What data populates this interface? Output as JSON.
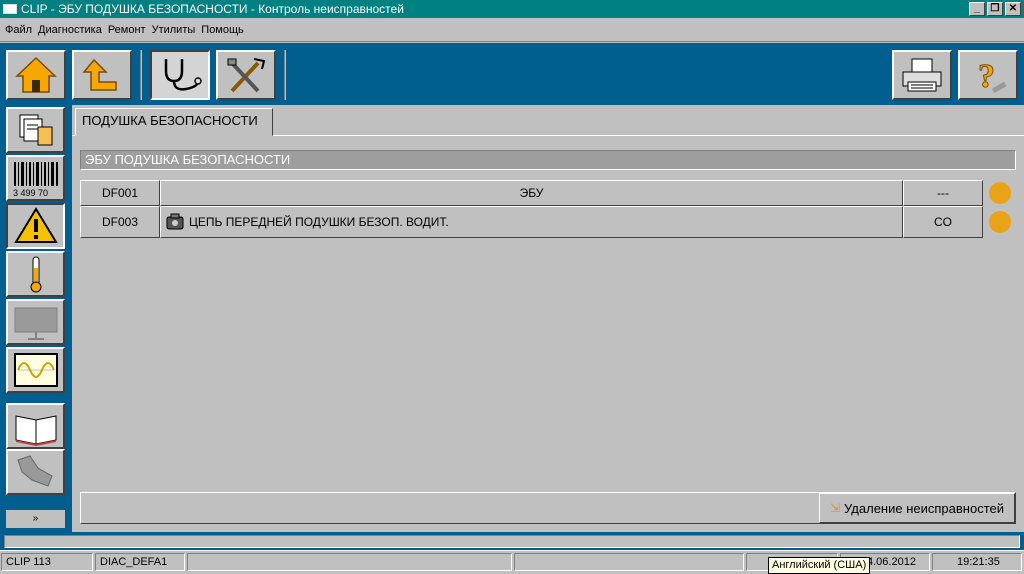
{
  "window": {
    "title": "CLIP - ЭБУ ПОДУШКА БЕЗОПАСНОСТИ - Контроль неисправностей",
    "controls": [
      "_",
      "❐",
      "✕"
    ]
  },
  "menu": [
    "Файл",
    "Диагностика",
    "Ремонт",
    "Утилиты",
    "Помощь"
  ],
  "toolbar": {
    "buttons": [
      {
        "name": "home-button",
        "icon": "home-icon"
      },
      {
        "name": "back-button",
        "icon": "arrow-up-icon"
      },
      {
        "name": "diagnostic-button",
        "icon": "stethoscope-icon"
      },
      {
        "name": "repair-button",
        "icon": "tools-icon"
      },
      {
        "name": "print-button",
        "icon": "printer-icon"
      },
      {
        "name": "help-button",
        "icon": "help-icon"
      }
    ]
  },
  "sidebar": {
    "buttons": [
      {
        "name": "documents",
        "icon": "documents-icon"
      },
      {
        "name": "barcode",
        "icon": "barcode-icon",
        "label": "3 499 70"
      },
      {
        "name": "faults",
        "icon": "warning-icon",
        "selected": true
      },
      {
        "name": "parameters",
        "icon": "thermometer-icon"
      },
      {
        "name": "states",
        "icon": "display-icon"
      },
      {
        "name": "oscilloscope",
        "icon": "wave-icon"
      },
      {
        "name": "manual",
        "icon": "book-icon"
      },
      {
        "name": "commands",
        "icon": "actuator-icon"
      }
    ],
    "scroll_label": "»"
  },
  "main": {
    "tab_label": "ПОДУШКА БЕЗОПАСНОСТИ",
    "section_title": "ЭБУ ПОДУШКА БЕЗОПАСНОСТИ",
    "faults": [
      {
        "code": "DF001",
        "description": "ЭБУ",
        "state": "---",
        "status_color": "#e8a317",
        "has_icon": false
      },
      {
        "code": "DF003",
        "description": "ЦЕПЬ ПЕРЕДНЕЙ ПОДУШКИ БЕЗОП. ВОДИТ.",
        "state": "CO",
        "status_color": "#e8a317",
        "has_icon": true
      }
    ],
    "clear_button_label": "Удаление неисправностей"
  },
  "status": {
    "version": "CLIP 113",
    "file": "DIAC_DEFA1",
    "date": "4.06.2012",
    "time": "19:21:35"
  },
  "tooltip": "Английский (США)"
}
